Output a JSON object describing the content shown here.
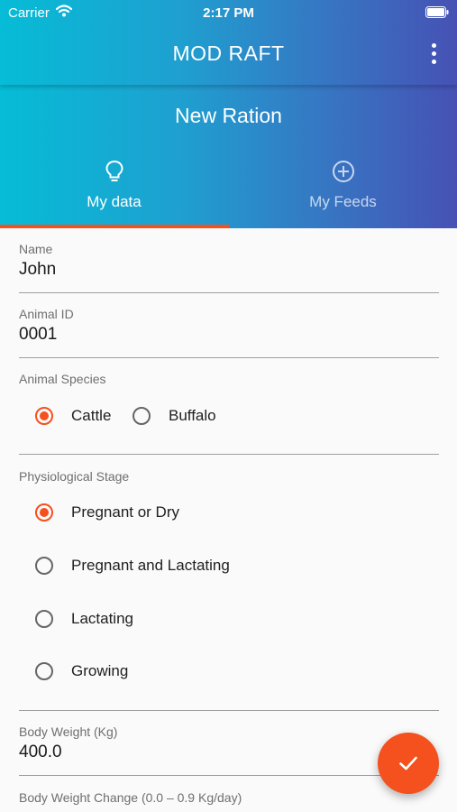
{
  "status_bar": {
    "carrier": "Carrier",
    "time": "2:17 PM"
  },
  "app_bar": {
    "title": "MOD RAFT",
    "menu_icon": "more-vert-icon"
  },
  "screen": {
    "title": "New Ration"
  },
  "tabs": [
    {
      "label": "My data",
      "icon": "lightbulb-icon",
      "selected": true
    },
    {
      "label": "My Feeds",
      "icon": "add-circle-icon",
      "selected": false
    }
  ],
  "form": {
    "name": {
      "label": "Name",
      "value": "John"
    },
    "animal_id": {
      "label": "Animal ID",
      "value": "0001"
    },
    "species": {
      "label": "Animal Species",
      "options": [
        {
          "label": "Cattle",
          "selected": true
        },
        {
          "label": "Buffalo",
          "selected": false
        }
      ]
    },
    "stage": {
      "label": "Physiological Stage",
      "options": [
        {
          "label": "Pregnant or Dry",
          "selected": true
        },
        {
          "label": "Pregnant and Lactating",
          "selected": false
        },
        {
          "label": "Lactating",
          "selected": false
        },
        {
          "label": "Growing",
          "selected": false
        }
      ]
    },
    "body_weight": {
      "label": "Body Weight (Kg)",
      "value": "400.0"
    },
    "weight_change": {
      "label": "Body Weight Change (0.0 – 0.9 Kg/day)"
    }
  },
  "fab": {
    "icon": "check-icon"
  },
  "colors": {
    "accent": "#f4511e",
    "gradient_start": "#06bcd6",
    "gradient_end": "#4651b4"
  }
}
